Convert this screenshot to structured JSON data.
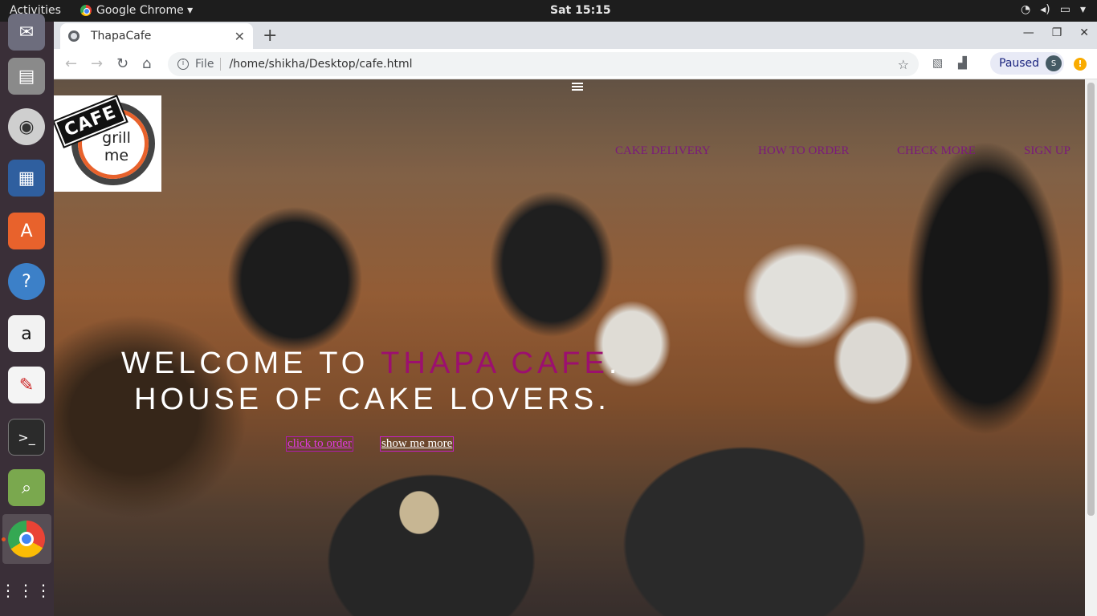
{
  "system": {
    "activities": "Activities",
    "app_menu": "Google Chrome ▾",
    "clock": "Sat 15:15",
    "tray": [
      "wifi-icon",
      "volume-icon",
      "battery-icon",
      "power-menu-icon"
    ]
  },
  "dock": {
    "items": [
      "mail-icon",
      "file-manager-icon",
      "speaker-icon",
      "writer-icon",
      "software-center-icon",
      "help-icon",
      "amazon-icon",
      "text-editor-icon",
      "terminal-icon",
      "image-viewer-icon",
      "chrome-icon",
      "show-apps-icon"
    ]
  },
  "browser": {
    "tab_title": "ThapaCafe",
    "scheme": "File",
    "url": "/home/shikha/Desktop/cafe.html",
    "profile_status": "Paused",
    "profile_initial": "S",
    "alert": "!"
  },
  "page": {
    "logo": {
      "badge": "CAFE",
      "line1": "grill",
      "line2": "me"
    },
    "nav": [
      "CAKE DELIVERY",
      "HOW TO ORDER",
      "CHECK MORE",
      "SIGN UP"
    ],
    "hero": {
      "line1_prefix": "WELCOME TO ",
      "line1_accent": "THAPA CAFE",
      "line1_suffix": ".",
      "line2": "HOUSE OF CAKE LOVERS."
    },
    "buttons": {
      "order": "click to order",
      "more": "show me more"
    }
  },
  "colors": {
    "accent": "#9c0f6f",
    "nav": "#7b1a7b",
    "button_border": "#b11ab0"
  }
}
